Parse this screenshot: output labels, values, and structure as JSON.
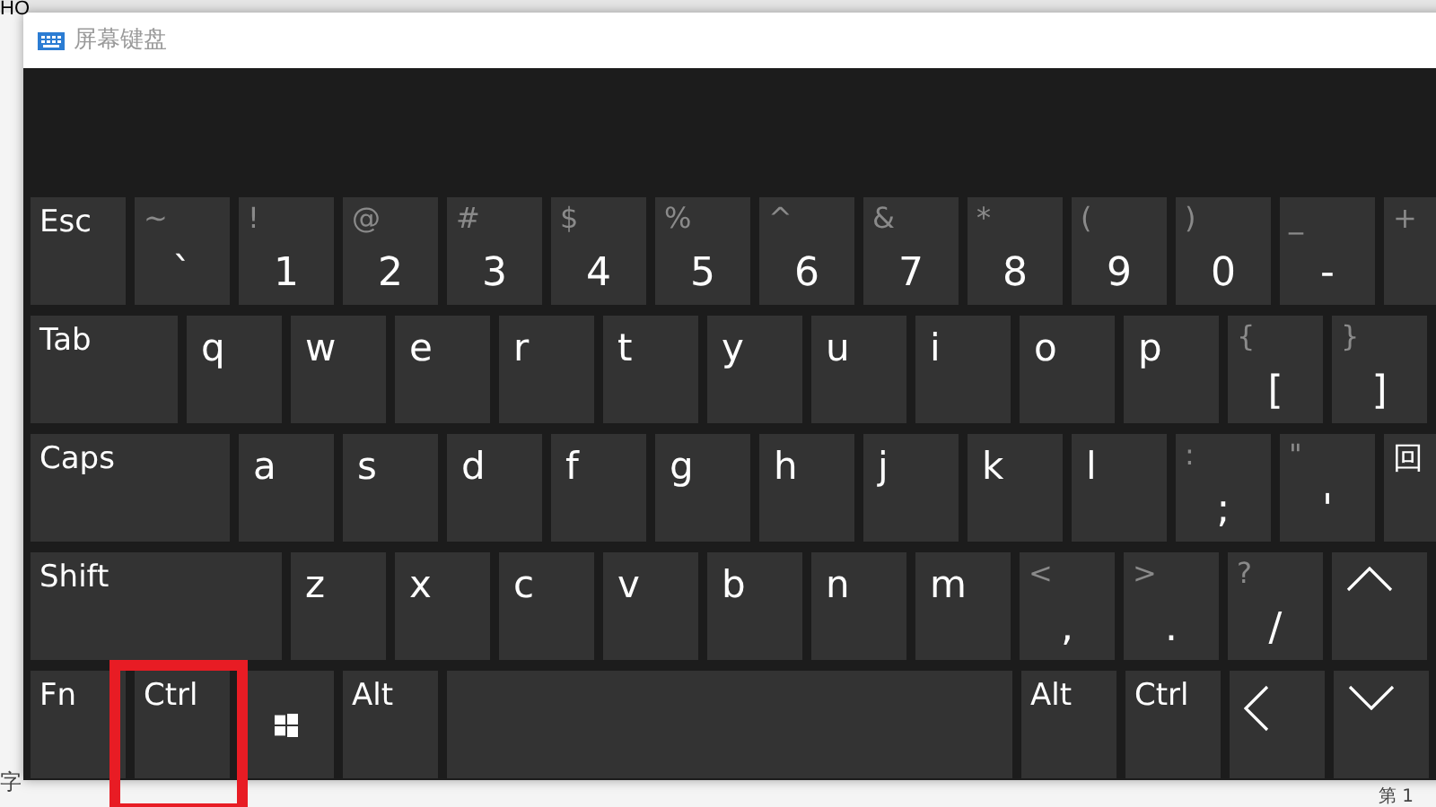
{
  "background": {
    "top_text": "HO",
    "bottom_left_text": "字",
    "bottom_right_text": "第 1"
  },
  "window": {
    "title": "屏幕键盘"
  },
  "rows": [
    [
      {
        "kind": "named",
        "label": "Esc"
      },
      {
        "kind": "dual",
        "shift": "~",
        "label": "`"
      },
      {
        "kind": "dual",
        "shift": "!",
        "label": "1"
      },
      {
        "kind": "dual",
        "shift": "@",
        "label": "2"
      },
      {
        "kind": "dual",
        "shift": "#",
        "label": "3"
      },
      {
        "kind": "dual",
        "shift": "$",
        "label": "4"
      },
      {
        "kind": "dual",
        "shift": "%",
        "label": "5"
      },
      {
        "kind": "dual",
        "shift": "^",
        "label": "6"
      },
      {
        "kind": "dual",
        "shift": "&",
        "label": "7"
      },
      {
        "kind": "dual",
        "shift": "*",
        "label": "8"
      },
      {
        "kind": "dual",
        "shift": "(",
        "label": "9"
      },
      {
        "kind": "dual",
        "shift": ")",
        "label": "0"
      },
      {
        "kind": "dual",
        "shift": "_",
        "label": "-"
      },
      {
        "kind": "dual",
        "shift": "+"
      }
    ],
    [
      {
        "kind": "tab",
        "label": "Tab"
      },
      {
        "kind": "letter",
        "label": "q"
      },
      {
        "kind": "letter",
        "label": "w"
      },
      {
        "kind": "letter",
        "label": "e"
      },
      {
        "kind": "letter",
        "label": "r"
      },
      {
        "kind": "letter",
        "label": "t"
      },
      {
        "kind": "letter",
        "label": "y"
      },
      {
        "kind": "letter",
        "label": "u"
      },
      {
        "kind": "letter",
        "label": "i"
      },
      {
        "kind": "letter",
        "label": "o"
      },
      {
        "kind": "letter",
        "label": "p"
      },
      {
        "kind": "dual",
        "shift": "{",
        "label": "["
      },
      {
        "kind": "dual",
        "shift": "}",
        "label": "]"
      }
    ],
    [
      {
        "kind": "caps",
        "label": "Caps"
      },
      {
        "kind": "letter",
        "label": "a"
      },
      {
        "kind": "letter",
        "label": "s"
      },
      {
        "kind": "letter",
        "label": "d"
      },
      {
        "kind": "letter",
        "label": "f"
      },
      {
        "kind": "letter",
        "label": "g"
      },
      {
        "kind": "letter",
        "label": "h"
      },
      {
        "kind": "letter",
        "label": "j"
      },
      {
        "kind": "letter",
        "label": "k"
      },
      {
        "kind": "letter",
        "label": "l"
      },
      {
        "kind": "dual",
        "shift": ":",
        "label": ";"
      },
      {
        "kind": "dual",
        "shift": "\"",
        "label": "'"
      },
      {
        "kind": "named",
        "label": "回"
      }
    ],
    [
      {
        "kind": "shift",
        "label": "Shift"
      },
      {
        "kind": "letter",
        "label": "z"
      },
      {
        "kind": "letter",
        "label": "x"
      },
      {
        "kind": "letter",
        "label": "c"
      },
      {
        "kind": "letter",
        "label": "v"
      },
      {
        "kind": "letter",
        "label": "b"
      },
      {
        "kind": "letter",
        "label": "n"
      },
      {
        "kind": "letter",
        "label": "m"
      },
      {
        "kind": "dual",
        "shift": "<",
        "label": ","
      },
      {
        "kind": "dual",
        "shift": ">",
        "label": "."
      },
      {
        "kind": "dual",
        "shift": "?",
        "label": "/"
      },
      {
        "kind": "up"
      }
    ],
    [
      {
        "kind": "named",
        "label": "Fn"
      },
      {
        "kind": "named",
        "label": "Ctrl",
        "highlighted": true
      },
      {
        "kind": "windows"
      },
      {
        "kind": "named",
        "label": "Alt"
      },
      {
        "kind": "space"
      },
      {
        "kind": "named",
        "label": "Alt"
      },
      {
        "kind": "named",
        "label": "Ctrl"
      },
      {
        "kind": "left"
      },
      {
        "kind": "down"
      }
    ]
  ]
}
